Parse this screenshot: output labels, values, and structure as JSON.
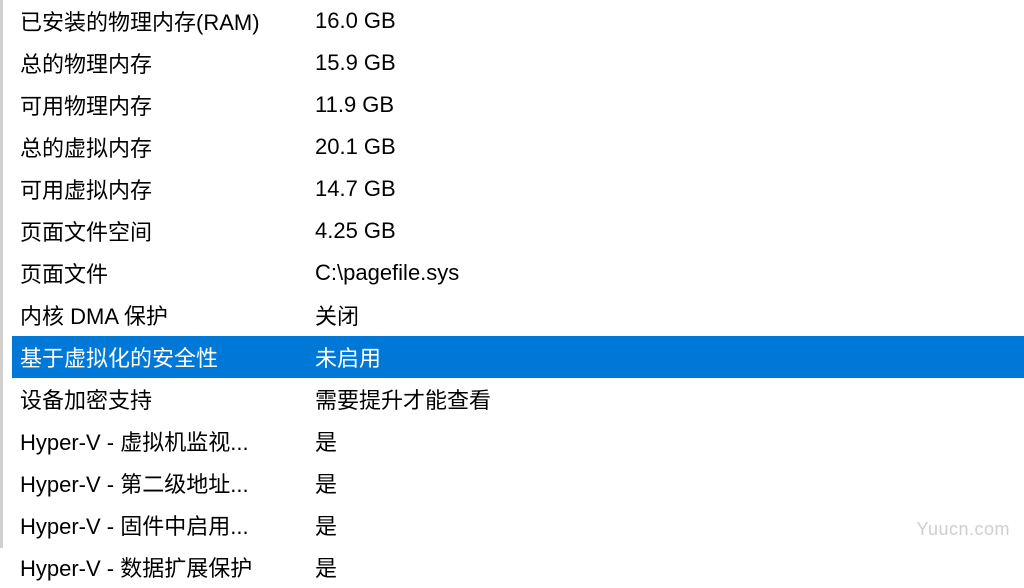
{
  "rows": [
    {
      "label": "已安装的物理内存(RAM)",
      "value": "16.0 GB",
      "selected": false
    },
    {
      "label": "总的物理内存",
      "value": "15.9 GB",
      "selected": false
    },
    {
      "label": "可用物理内存",
      "value": "11.9 GB",
      "selected": false
    },
    {
      "label": "总的虚拟内存",
      "value": "20.1 GB",
      "selected": false
    },
    {
      "label": "可用虚拟内存",
      "value": "14.7 GB",
      "selected": false
    },
    {
      "label": "页面文件空间",
      "value": "4.25 GB",
      "selected": false
    },
    {
      "label": "页面文件",
      "value": "C:\\pagefile.sys",
      "selected": false
    },
    {
      "label": "内核 DMA 保护",
      "value": "关闭",
      "selected": false
    },
    {
      "label": "基于虚拟化的安全性",
      "value": "未启用",
      "selected": true
    },
    {
      "label": "设备加密支持",
      "value": "需要提升才能查看",
      "selected": false
    },
    {
      "label": "Hyper-V - 虚拟机监视...",
      "value": "是",
      "selected": false
    },
    {
      "label": "Hyper-V - 第二级地址...",
      "value": "是",
      "selected": false
    },
    {
      "label": "Hyper-V - 固件中启用...",
      "value": "是",
      "selected": false
    },
    {
      "label": "Hyper-V - 数据扩展保护",
      "value": "是",
      "selected": false
    }
  ],
  "watermark": "Yuucn.com"
}
